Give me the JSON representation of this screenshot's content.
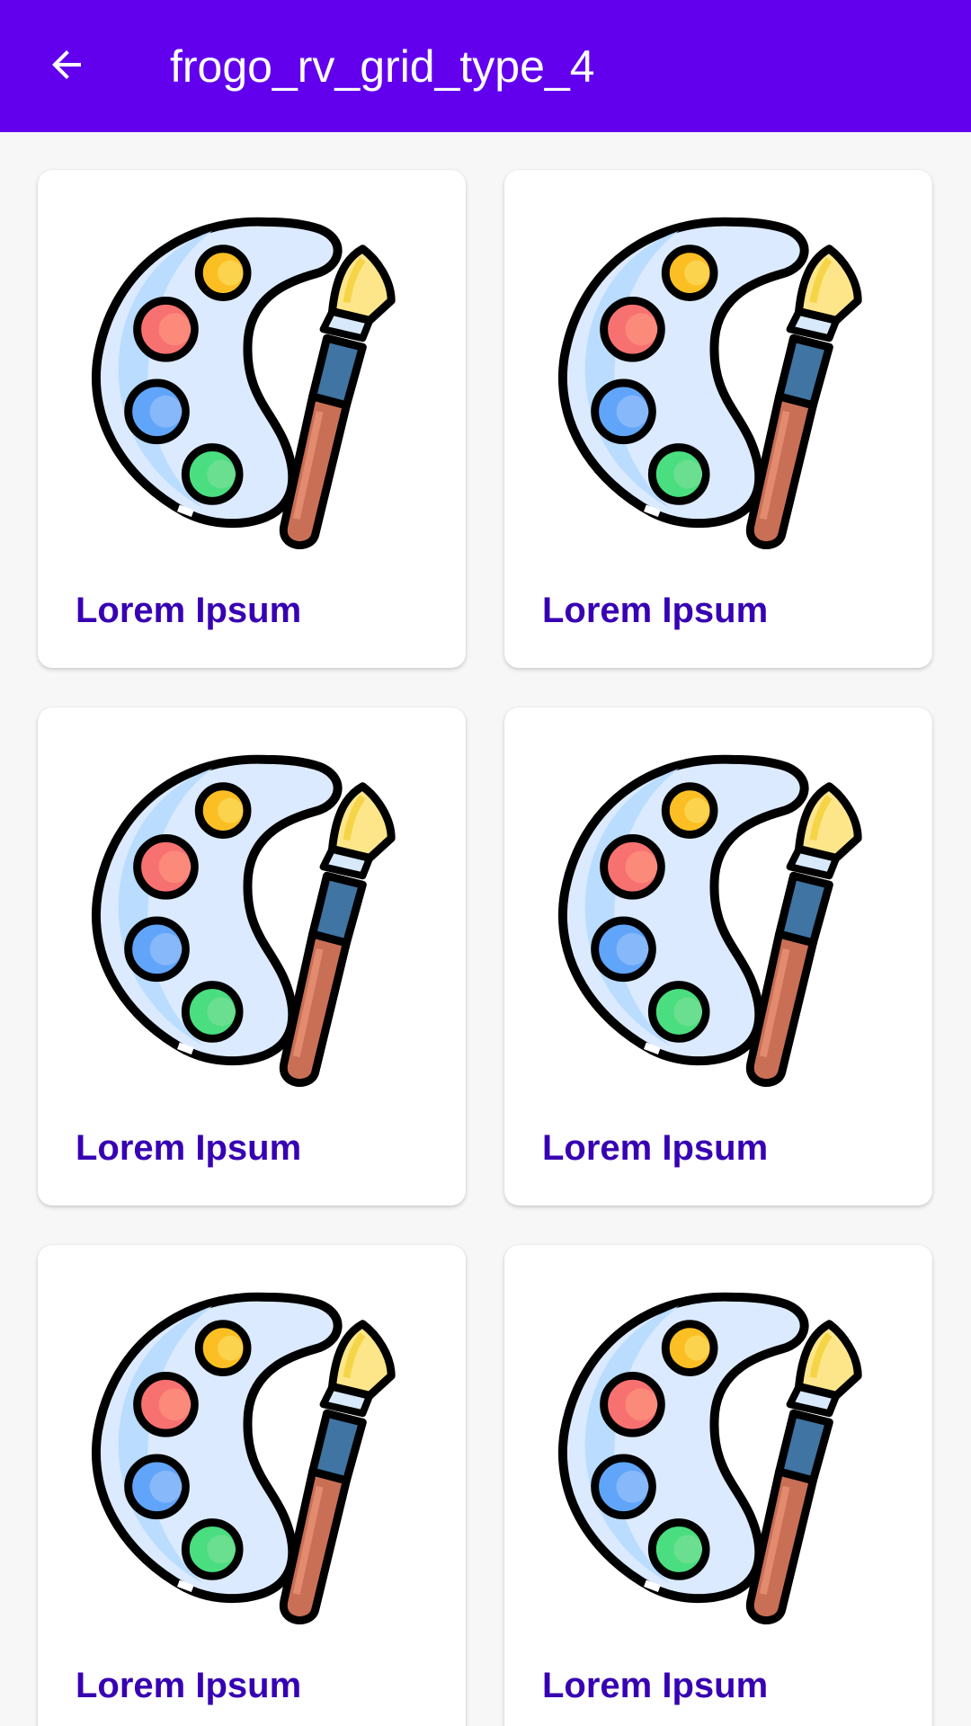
{
  "appbar": {
    "title": "frogo_rv_grid_type_4",
    "back_icon": "arrow-back-icon",
    "background_color": "#6200ee"
  },
  "items": [
    {
      "label": "Lorem Ipsum",
      "icon": "paint-palette-icon"
    },
    {
      "label": "Lorem Ipsum",
      "icon": "paint-palette-icon"
    },
    {
      "label": "Lorem Ipsum",
      "icon": "paint-palette-icon"
    },
    {
      "label": "Lorem Ipsum",
      "icon": "paint-palette-icon"
    },
    {
      "label": "Lorem Ipsum",
      "icon": "paint-palette-icon"
    },
    {
      "label": "Lorem Ipsum",
      "icon": "paint-palette-icon"
    }
  ],
  "colors": {
    "label_text": "#3700b3",
    "page_background": "#f7f7f7",
    "card_background": "#ffffff"
  }
}
